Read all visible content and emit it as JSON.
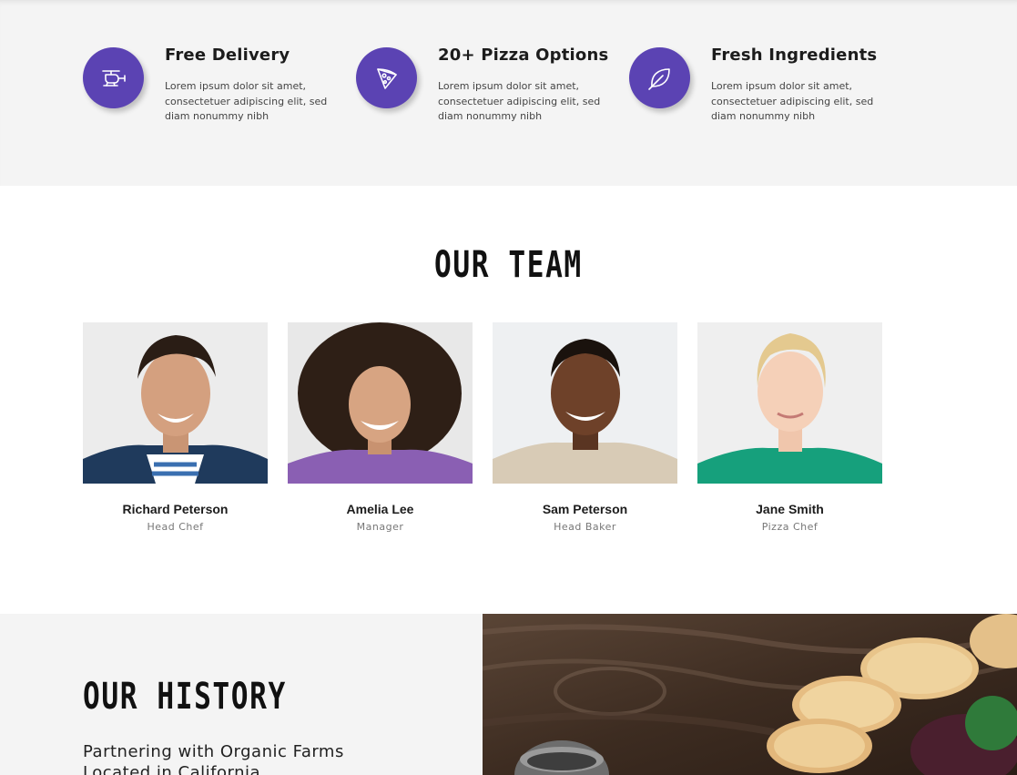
{
  "features": [
    {
      "icon": "helicopter-icon",
      "title": "Free Delivery",
      "text": "Lorem ipsum dolor sit amet, consectetuer adipiscing elit, sed diam nonummy nibh"
    },
    {
      "icon": "pizza-slice-icon",
      "title": "20+ Pizza Options",
      "text": "Lorem ipsum dolor sit amet, consectetuer adipiscing elit, sed diam nonummy nibh"
    },
    {
      "icon": "leaf-icon",
      "title": "Fresh Ingredients",
      "text": "Lorem ipsum dolor sit amet, consectetuer adipiscing elit, sed diam nonummy nibh"
    }
  ],
  "team": {
    "title": "OUR TEAM",
    "members": [
      {
        "name": "Richard Peterson",
        "role": "Head Chef"
      },
      {
        "name": "Amelia Lee",
        "role": "Manager"
      },
      {
        "name": "Sam Peterson",
        "role": "Head Baker"
      },
      {
        "name": "Jane Smith",
        "role": "Pizza Chef"
      }
    ]
  },
  "history": {
    "title": "OUR HISTORY",
    "subtitle": "Partnering with Organic Farms Located in California"
  },
  "colors": {
    "accent": "#5b43b3",
    "section_bg": "#f4f4f4"
  }
}
